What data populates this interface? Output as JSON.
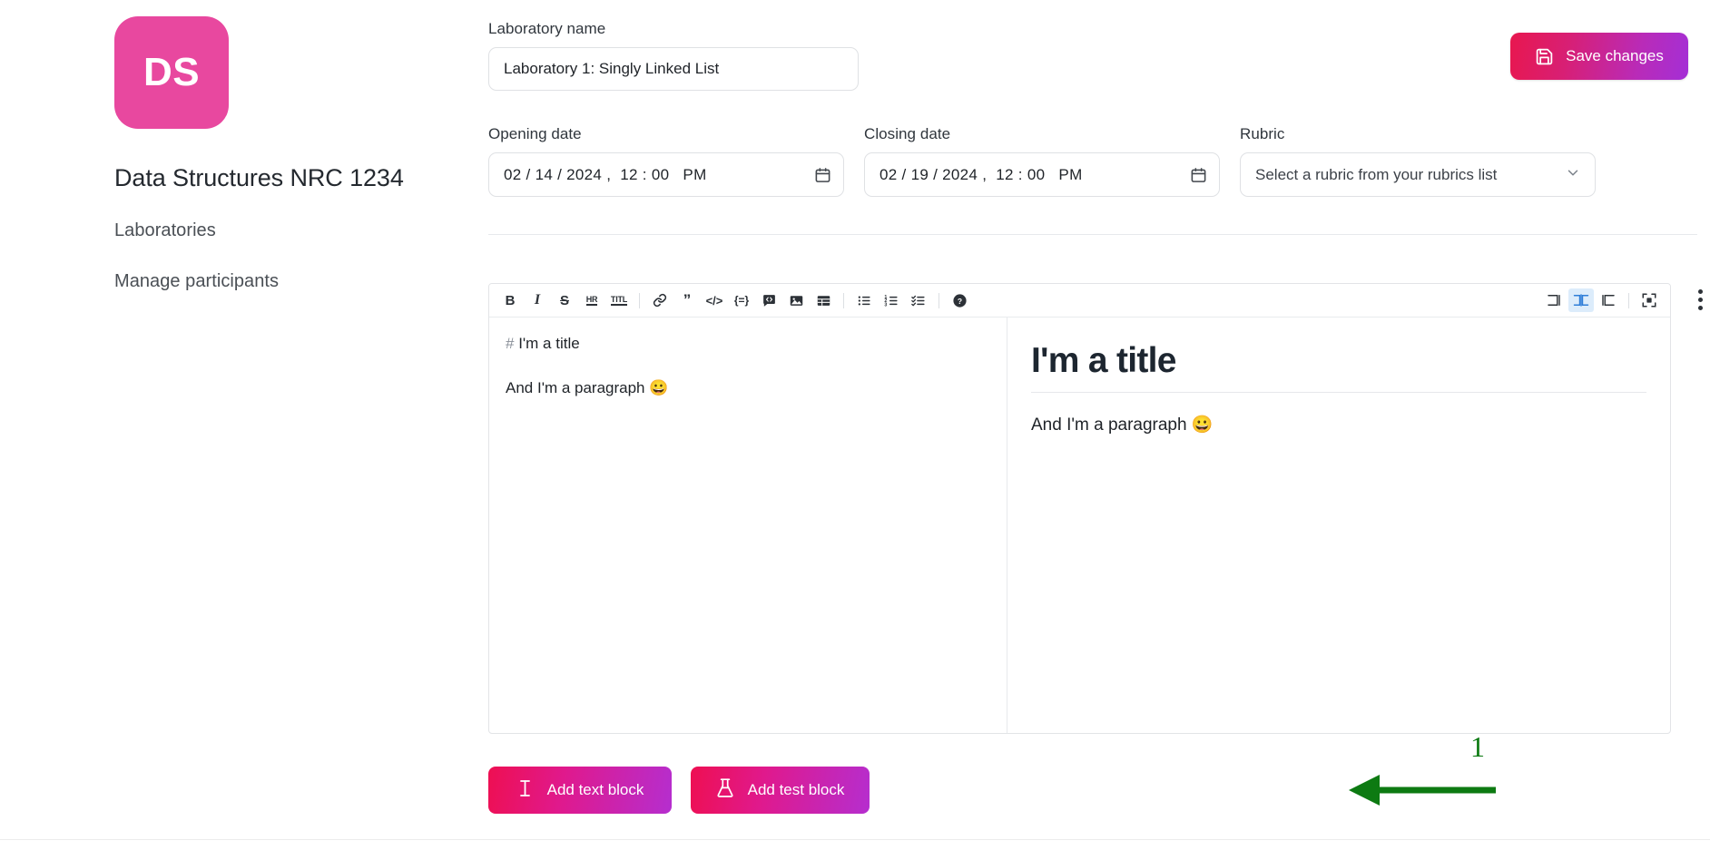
{
  "sidebar": {
    "logo_initials": "DS",
    "logo_color": "#e8489f",
    "course_title": "Data Structures NRC 1234",
    "items": [
      {
        "label": "Laboratories",
        "name": "laboratories"
      },
      {
        "label": "Manage participants",
        "name": "manage-participants"
      }
    ]
  },
  "form": {
    "lab_name_label": "Laboratory name",
    "lab_name_value": "Laboratory 1: Singly Linked List",
    "lab_name_placeholder": "Laboratory name",
    "opening_date_label": "Opening date",
    "opening_date_value": "02 / 14 / 2024 ,  12 : 00   PM",
    "closing_date_label": "Closing date",
    "closing_date_value": "02 / 19 / 2024 ,  12 : 00   PM",
    "rubric_label": "Rubric",
    "rubric_value": "Select a rubric from your rubrics list"
  },
  "toolbar": {
    "save_label": "Save changes",
    "save_gradient_from": "#e8174f",
    "save_gradient_to": "#a42fd6"
  },
  "editor": {
    "toolbar_buttons": [
      {
        "name": "bold-icon",
        "label": "B",
        "title": "Bold"
      },
      {
        "name": "italic-icon",
        "label": "I",
        "title": "Italic"
      },
      {
        "name": "strikethrough-icon",
        "label": "S",
        "title": "Strikethrough"
      },
      {
        "name": "horizontal-rule-icon",
        "label": "HR",
        "title": "Horizontal rule"
      },
      {
        "name": "title-icon",
        "label": "TITL",
        "title": "Title"
      },
      {
        "name": "link-icon",
        "label": "",
        "title": "Link"
      },
      {
        "name": "quote-icon",
        "label": "”",
        "title": "Quote"
      },
      {
        "name": "inline-code-icon",
        "label": "</>",
        "title": "Inline code"
      },
      {
        "name": "code-block-icon",
        "label": "{=}",
        "title": "Code block"
      },
      {
        "name": "comment-icon",
        "label": "",
        "title": "Comment"
      },
      {
        "name": "image-icon",
        "label": "",
        "title": "Image"
      },
      {
        "name": "table-icon",
        "label": "",
        "title": "Table"
      },
      {
        "name": "unordered-list-icon",
        "label": "",
        "title": "Unordered list"
      },
      {
        "name": "ordered-list-icon",
        "label": "",
        "title": "Ordered list"
      },
      {
        "name": "checklist-icon",
        "label": "",
        "title": "Check list"
      },
      {
        "name": "help-icon",
        "label": "?",
        "title": "Help"
      }
    ],
    "view_modes": [
      {
        "name": "edit-only-view-icon",
        "title": "Editor only",
        "active": false
      },
      {
        "name": "split-view-icon",
        "title": "Split view",
        "active": true
      },
      {
        "name": "preview-only-view-icon",
        "title": "Preview only",
        "active": false
      }
    ],
    "fullscreen_title": "Fullscreen",
    "kebab_title": "More options",
    "source_hash": "#",
    "source_title": "I'm a title",
    "source_paragraph": "And I'm a paragraph 😀",
    "preview_title": "I'm a title",
    "preview_paragraph": "And I'm a paragraph 😀"
  },
  "blocks": {
    "add_text_block_label": "Add text block",
    "add_test_block_label": "Add test block",
    "gradient_from": "#ee0f52",
    "gradient_to": "#b52ecf"
  },
  "annotation": {
    "number": "1",
    "color": "#0d7a12",
    "points_to": "Add test block"
  }
}
